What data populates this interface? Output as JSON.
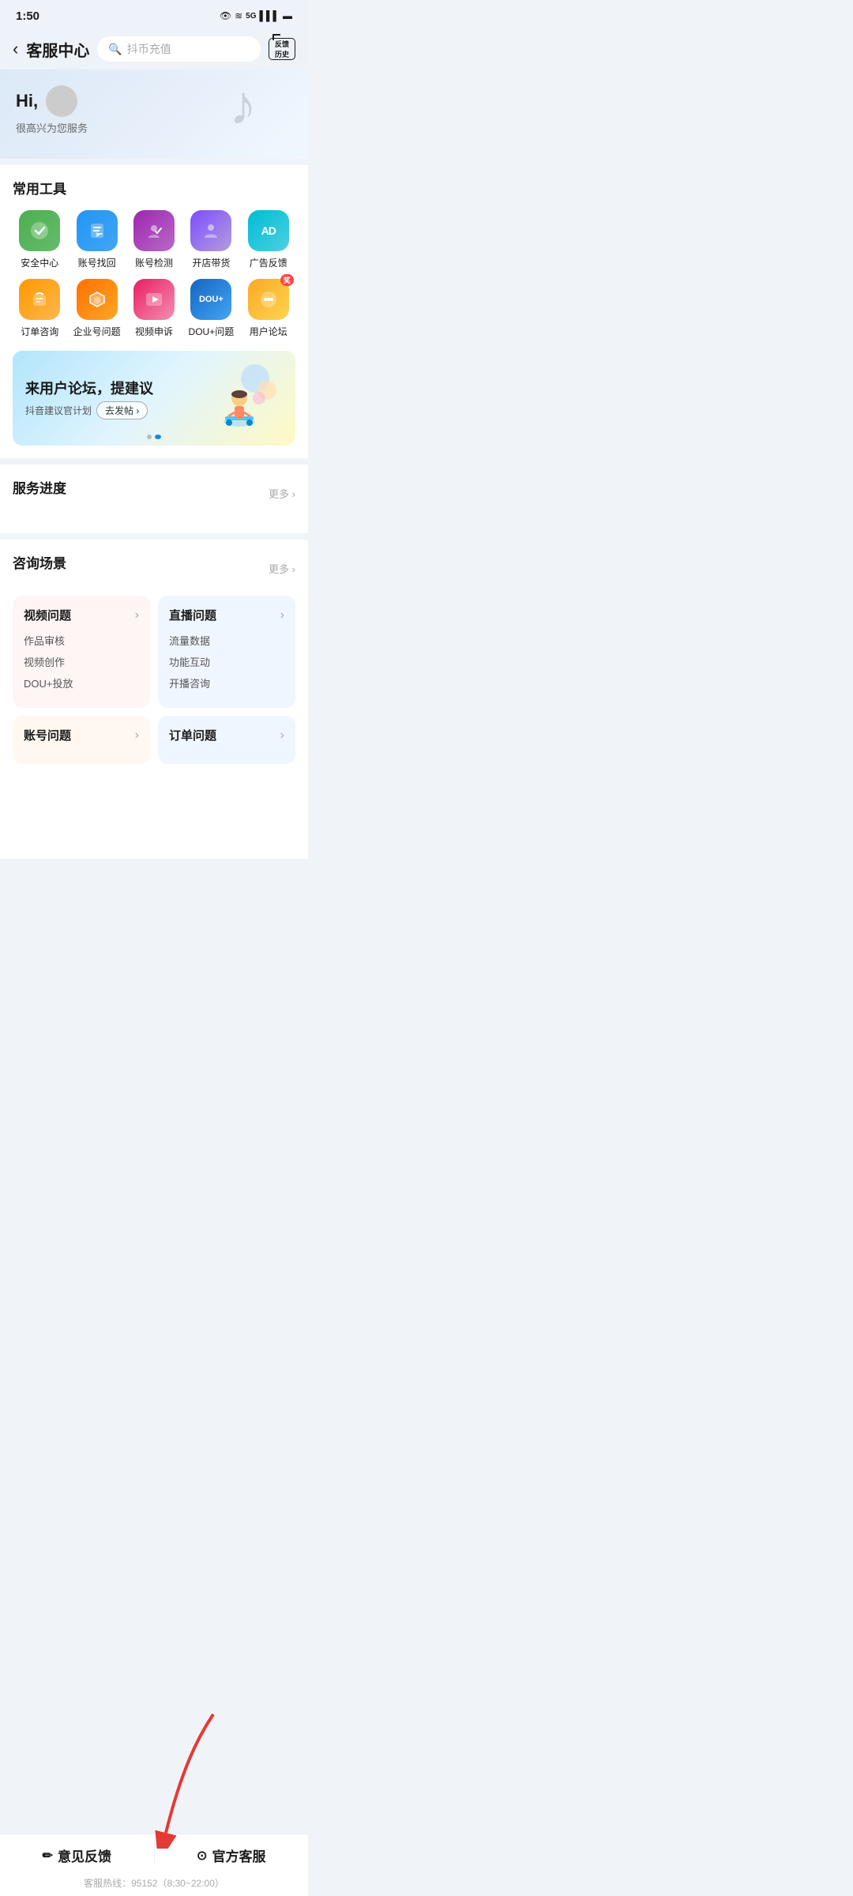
{
  "statusBar": {
    "time": "1:50",
    "icons": "👁 ≈ 5G ▌▌▌ 🔋"
  },
  "header": {
    "back": "‹",
    "title": "客服中心",
    "searchPlaceholder": "抖币充值",
    "feedbackLabel": "反馈\n历史"
  },
  "hero": {
    "greeting": "Hi,",
    "sub": "很高兴为您服务"
  },
  "tools": {
    "sectionTitle": "常用工具",
    "items": [
      {
        "id": "security",
        "label": "安全中心",
        "iconColor": "icon-green",
        "icon": "✓"
      },
      {
        "id": "account-retrieve",
        "label": "账号找回",
        "iconColor": "icon-blue",
        "icon": "↩"
      },
      {
        "id": "account-check",
        "label": "账号检测",
        "iconColor": "icon-purple",
        "icon": "∿"
      },
      {
        "id": "shop",
        "label": "开店带货",
        "iconColor": "icon-violet",
        "icon": "👤"
      },
      {
        "id": "ad-feedback",
        "label": "广告反馈",
        "iconColor": "icon-teal",
        "icon": "AD"
      },
      {
        "id": "order",
        "label": "订单咨询",
        "iconColor": "icon-orange",
        "icon": "🛍"
      },
      {
        "id": "enterprise",
        "label": "企业号问题",
        "iconColor": "icon-amber",
        "icon": "◈"
      },
      {
        "id": "video-appeal",
        "label": "视频申诉",
        "iconColor": "icon-pink",
        "icon": "▶"
      },
      {
        "id": "dou-plus",
        "label": "DOU+问题",
        "iconColor": "icon-blue2",
        "icon": "DOU+"
      },
      {
        "id": "forum",
        "label": "用户论坛",
        "iconColor": "icon-yellow",
        "icon": "💬",
        "badge": "奖"
      }
    ]
  },
  "banner": {
    "title": "来用户论坛，提建议",
    "sub": "抖音建议官计划",
    "btnLabel": "去发帖 ›",
    "dots": [
      false,
      true
    ]
  },
  "serviceProgress": {
    "sectionTitle": "服务进度",
    "moreLabel": "更多 ›"
  },
  "consultScene": {
    "sectionTitle": "咨询场景",
    "moreLabel": "更多 ›",
    "cards": [
      {
        "id": "video-issues",
        "title": "视频问题",
        "colorClass": "red",
        "items": [
          "作品审核",
          "视频创作",
          "DOU+投放"
        ]
      },
      {
        "id": "live-issues",
        "title": "直播问题",
        "colorClass": "blue",
        "items": [
          "流量数据",
          "功能互动",
          "开播咨询"
        ]
      },
      {
        "id": "account-issues",
        "title": "账号问题",
        "colorClass": "orange",
        "items": []
      },
      {
        "id": "order-issues",
        "title": "订单问题",
        "colorClass": "blue",
        "items": []
      }
    ]
  },
  "bottomNav": {
    "feedbackIcon": "✏",
    "feedbackLabel": "意见反馈",
    "serviceIcon": "⊙",
    "serviceLabel": "官方客服",
    "hotline": "客服热线：95152（8:30~22:00）"
  }
}
